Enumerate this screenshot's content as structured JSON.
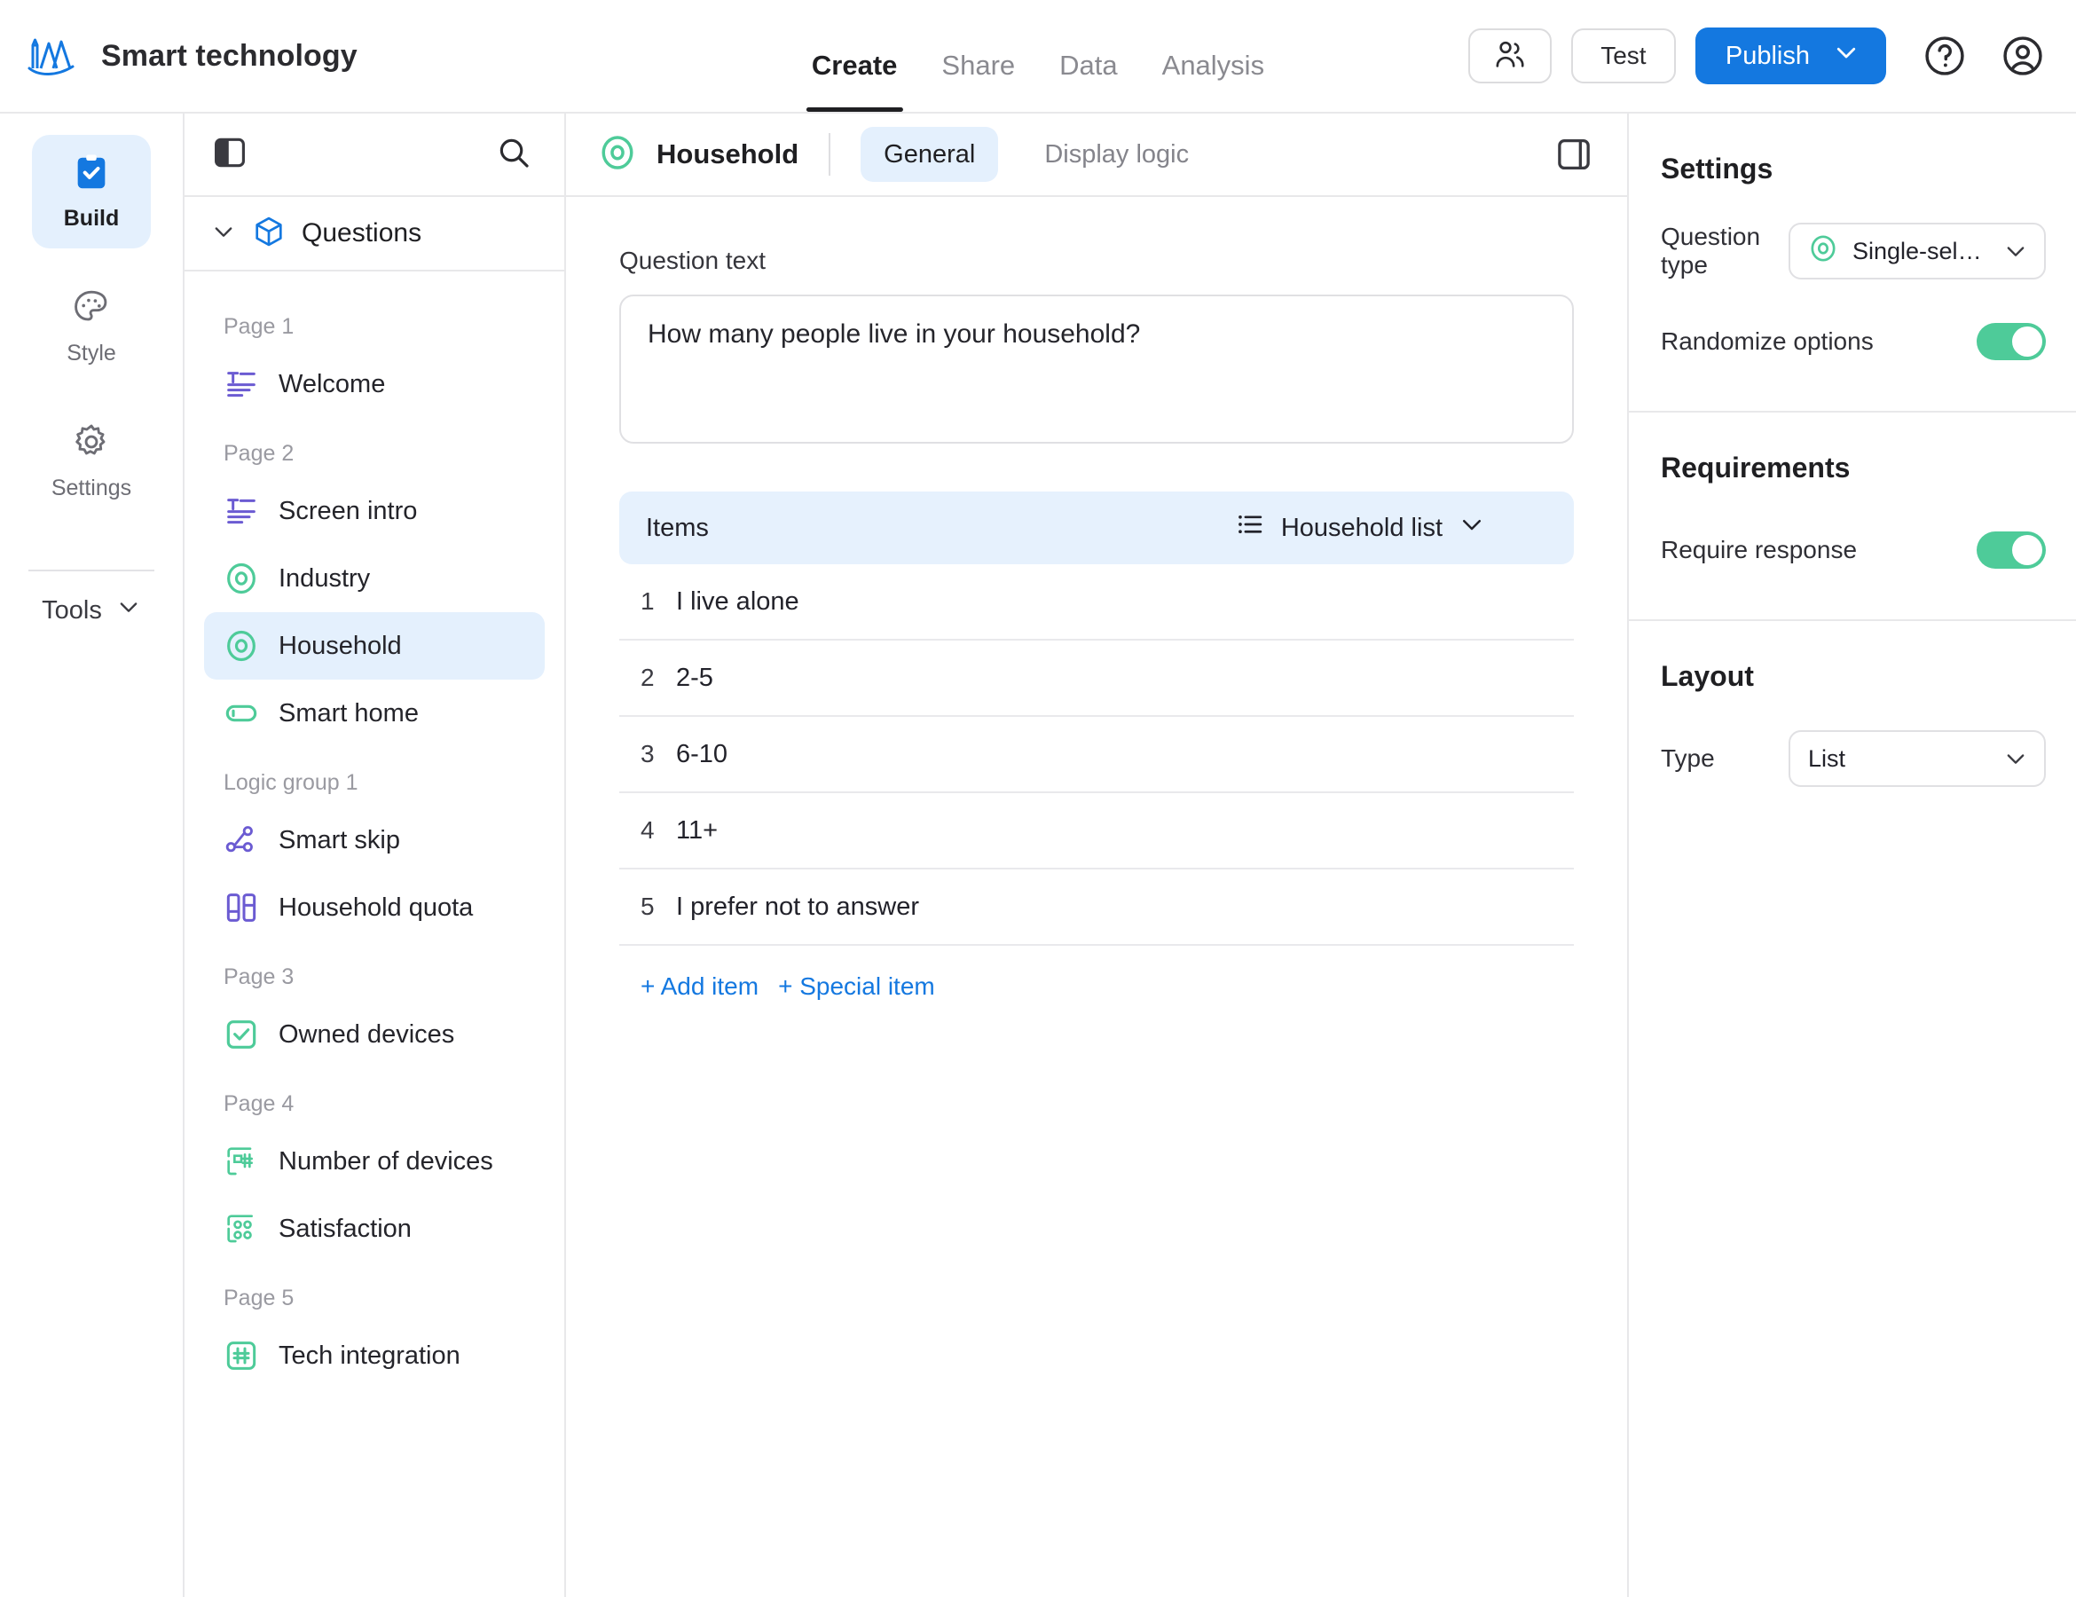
{
  "header": {
    "brand_name": "Smart technology",
    "logo_icon": "mountains-logo-icon",
    "tabs": [
      {
        "label": "Create",
        "active": true
      },
      {
        "label": "Share",
        "active": false
      },
      {
        "label": "Data",
        "active": false
      },
      {
        "label": "Analysis",
        "active": false
      }
    ],
    "collaborators_icon": "people-icon",
    "test_label": "Test",
    "publish_label": "Publish",
    "publish_caret_icon": "chevron-down-icon",
    "help_icon": "help-circle-icon",
    "account_icon": "user-circle-icon",
    "accent_color": "#1478e0"
  },
  "rail": {
    "items": [
      {
        "label": "Build",
        "icon": "clipboard-check-icon",
        "active": true
      },
      {
        "label": "Style",
        "icon": "palette-icon",
        "active": false
      },
      {
        "label": "Settings",
        "icon": "gear-icon",
        "active": false
      }
    ],
    "tools_label": "Tools",
    "tools_caret_icon": "chevron-down-icon"
  },
  "tree": {
    "panel_toggle_icon": "sidebar-collapse-icon",
    "search_icon": "search-icon",
    "root_label": "Questions",
    "root_icon": "cube-icon",
    "root_caret_icon": "chevron-down-icon",
    "groups": [
      {
        "label": "Page 1",
        "items": [
          {
            "label": "Welcome",
            "icon": "text-block-icon",
            "color": "#6b5bd2",
            "selected": false
          }
        ]
      },
      {
        "label": "Page 2",
        "items": [
          {
            "label": "Screen intro",
            "icon": "text-block-icon",
            "color": "#6b5bd2",
            "selected": false
          },
          {
            "label": "Industry",
            "icon": "single-select-icon",
            "color": "#4ecb99",
            "selected": false
          },
          {
            "label": "Household",
            "icon": "single-select-icon",
            "color": "#4ecb99",
            "selected": true
          },
          {
            "label": "Smart home",
            "icon": "text-input-icon",
            "color": "#4ecb99",
            "selected": false
          }
        ]
      },
      {
        "label": "Logic group 1",
        "items": [
          {
            "label": "Smart skip",
            "icon": "branch-logic-icon",
            "color": "#6b5bd2",
            "selected": false
          },
          {
            "label": "Household quota",
            "icon": "quota-columns-icon",
            "color": "#6b5bd2",
            "selected": false
          }
        ]
      },
      {
        "label": "Page 3",
        "items": [
          {
            "label": "Owned devices",
            "icon": "checkbox-icon",
            "color": "#4ecb99",
            "selected": false
          }
        ]
      },
      {
        "label": "Page 4",
        "items": [
          {
            "label": "Number of devices",
            "icon": "numeric-grid-icon",
            "color": "#4ecb99",
            "selected": false
          },
          {
            "label": "Satisfaction",
            "icon": "matrix-grid-icon",
            "color": "#4ecb99",
            "selected": false
          }
        ]
      },
      {
        "label": "Page 5",
        "items": [
          {
            "label": "Tech integration",
            "icon": "number-box-icon",
            "color": "#4ecb99",
            "selected": false
          }
        ]
      }
    ]
  },
  "editor": {
    "question_title": "Household",
    "question_title_icon": "single-select-icon",
    "tabs": [
      {
        "label": "General",
        "active": true
      },
      {
        "label": "Display logic",
        "active": false
      }
    ],
    "panel_toggle_icon": "right-panel-toggle-icon",
    "question_text_label": "Question text",
    "question_text_value": "How many people live in your household?",
    "items_header_label": "Items",
    "items_source_label": "Household list",
    "items_source_icon": "list-icon",
    "items_source_caret_icon": "chevron-down-icon",
    "items": [
      {
        "num": "1",
        "text": "I live alone"
      },
      {
        "num": "2",
        "text": "2-5"
      },
      {
        "num": "3",
        "text": "6-10"
      },
      {
        "num": "4",
        "text": "11+"
      },
      {
        "num": "5",
        "text": "I prefer not to answer"
      }
    ],
    "add_item_label": "+ Add item",
    "special_item_label": "+ Special item",
    "link_color": "#1478e0"
  },
  "settings_panel": {
    "sections": [
      {
        "title": "Settings",
        "rows": [
          {
            "label": "Question type",
            "control": "select",
            "value": "Single-select",
            "icon": "single-select-icon",
            "caret_icon": "chevron-down-icon"
          },
          {
            "label": "Randomize options",
            "control": "toggle",
            "value": "on"
          }
        ]
      },
      {
        "title": "Requirements",
        "rows": [
          {
            "label": "Require response",
            "control": "toggle",
            "value": "on"
          }
        ]
      },
      {
        "title": "Layout",
        "rows": [
          {
            "label": "Type",
            "control": "select",
            "value": "List",
            "caret_icon": "chevron-down-icon"
          }
        ]
      }
    ],
    "toggle_on_color": "#4ecb99"
  }
}
